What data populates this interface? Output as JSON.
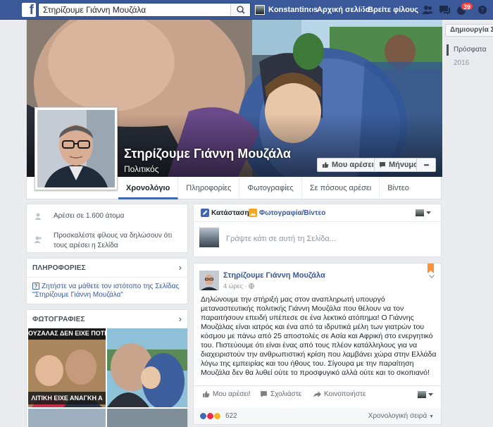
{
  "topbar": {
    "logo": "f",
    "search_value": "Στηρίζουμε Γιάννη Μουζάλα",
    "user_name": "Konstantinos",
    "home_label": "Αρχική σελίδα",
    "find_friends_label": "Βρείτε φίλους",
    "notifications_count": "39",
    "brand_color": "#3b5998"
  },
  "page": {
    "name": "Στηρίζουμε Γιάννη Μουζάλα",
    "category": "Πολιτικός",
    "like_button": "Μου αρέσει!",
    "message_button": "Μήνυμα",
    "more_button": "•••",
    "tabs": [
      {
        "label": "Χρονολόγιο"
      },
      {
        "label": "Πληροφορίες"
      },
      {
        "label": "Φωτογραφίες"
      },
      {
        "label": "Σε πόσους αρέσει"
      },
      {
        "label": "Βίντεο"
      }
    ]
  },
  "right_rail": {
    "create_page": "Δημιουργία Σελίδας",
    "recent": "Πρόσφατα",
    "year": "2016"
  },
  "left_column": {
    "likes_text": "Αρέσει σε 1.600 άτομα",
    "invite_text": "Προσκαλέστε φίλους να δηλώσουν ότι τους αρέσει η Σελίδα",
    "info_header": "ΠΛΗΡΟΦΟΡΙΕΣ",
    "info_link": "Ζητήστε να μάθετε τον ιστότοπο της Σελίδας \"Στηρίζουμε Γιάννη Μουζάλα\"",
    "photos_header": "ΦΩΤΟΓΡΑΦΙΕΣ",
    "photo_caption_top": "ΟΥΖΑΛΑΣ ΔΕΝ ΕΙΧΕ ΠΟΤΕ",
    "photo_caption_bottom": "ΛΙΤΙΚΗ ΕΙΧΕ ΑΝΑΓΚΗ Α"
  },
  "composer": {
    "status_tab": "Κατάσταση",
    "photo_tab": "Φωτογραφία/Βίντεο",
    "placeholder": "Γράψτε κάτι σε αυτή τη Σελίδα..."
  },
  "post": {
    "author": "Στηρίζουμε Γιάννη Μουζάλα",
    "time": "4 ώρες ·",
    "body": "Δηλώνουμε την στήριξή μας στον αναπληρωτή υπουργό μεταναστευτικής πολιτικής Γιάννη Μουζάλα που θέλουν να τον παραιτήσουν επειδή υπέπεσε σε ένα λεκτικό ατόπημα! Ο Γιάννης Μουζάλας είναι ιατρός και ένα από τα ιδρυτικά μέλη των γιατρών του κόσμου με πάνω από 25 αποστολές σε Ασία και Αφρική στο ενεργητικό του. Πιστεύουμε ότι είναι ένας από τους πλέον κατάλληλους για να διαχειριστούν την ανθρωπιστική κρίση που λαμβάνει χώρα στην Ελλάδα λόγω της εμπειρίας και του ήθους του. Σίγουρα με την παραίτηση Μουζάλα δεν θα λυθεί ούτε το προσφυγικό αλλά ούτε και το σκοπιανό!",
    "like_action": "Μου αρέσει!",
    "comment_action": "Σχολιάστε",
    "share_action": "Κοινοποιήστε",
    "reaction_count": "622",
    "order_label": "Χρονολογική σειρά"
  }
}
